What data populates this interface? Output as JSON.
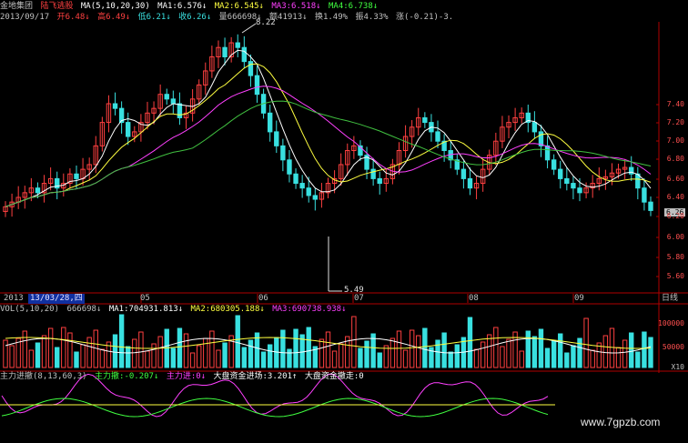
{
  "title_bar": {
    "company": "金地集团",
    "stock_name": "陆飞逃股",
    "ma_label": "MA(5,10,20,30)",
    "ma1": "MA1:6.576↓",
    "ma2": "MA2:6.545↓",
    "ma3": "MA3:6.518↓",
    "ma4": "MA4:6.738↓"
  },
  "ohlc_bar": {
    "date": "2013/09/17",
    "open": "开6.48↓",
    "high": "高6.49↓",
    "low": "低6.21↓",
    "close": "收6.26↓",
    "volume": "量666698↓",
    "amount": "额41913↓",
    "turnover": "换1.49%",
    "amplitude": "振4.33%",
    "change": "涨(-0.21)-3."
  },
  "price_panel": {
    "high_mark": "8.22",
    "low_mark": "5.49",
    "current_price_tag": "6.26",
    "y_ticks": [
      "7.40",
      "7.20",
      "7.00",
      "6.80",
      "6.60",
      "6.40",
      "6.20",
      "6.00",
      "5.80",
      "5.60"
    ]
  },
  "time_axis": {
    "year_tab": "2013",
    "selected_date": "13/03/28,四",
    "months": [
      "05",
      "06",
      "07",
      "08",
      "09"
    ],
    "period": "日线"
  },
  "volume_panel": {
    "label": "VOL(5,10,20)",
    "value": "666698↓",
    "ma1": "MA1:704931.813↓",
    "ma2": "MA2:680305.188↓",
    "ma3": "MA3:690738.938↓",
    "y_ticks": [
      "100000",
      "50000"
    ],
    "multiplier": "X10"
  },
  "indicator_panel": {
    "label": "主力进撤(8,13,60,3)",
    "main_force": "主力撤:-0.207↓",
    "main_force_in": "主力进:0↓",
    "market_in": "大盘资金进场:3.201↑",
    "market_out": "大盘资金撤走:0"
  },
  "watermark": "www.7gpzb.com",
  "colors": {
    "up": "#ff4040",
    "down": "#39e0e0",
    "ma1": "#ffffff",
    "ma2": "#ffff40",
    "ma3": "#ff40ff",
    "ma4": "#40c040",
    "axis": "#b00000"
  }
}
